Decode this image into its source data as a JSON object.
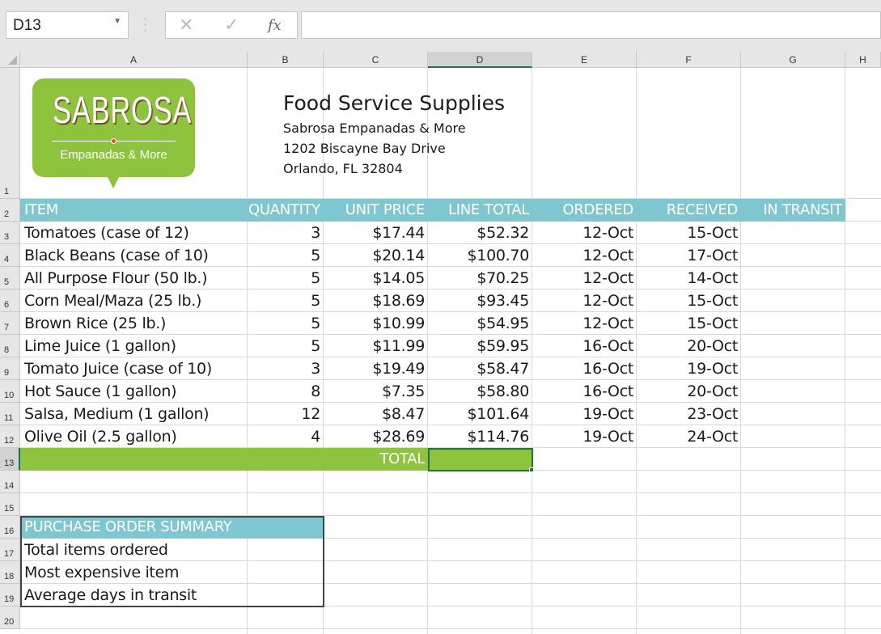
{
  "toolbar": {
    "name_box": "D13",
    "cancel_icon": "✕",
    "enter_icon": "✓",
    "fx_label": "fx",
    "formula": ""
  },
  "columns": [
    "A",
    "B",
    "C",
    "D",
    "E",
    "F",
    "G",
    "H"
  ],
  "rows": [
    "1",
    "2",
    "3",
    "4",
    "5",
    "6",
    "7",
    "8",
    "9",
    "10",
    "11",
    "12",
    "13",
    "14",
    "15",
    "16",
    "17",
    "18",
    "19",
    "20"
  ],
  "logo": {
    "title": "SABROSA",
    "subtitle": "Empanadas & More"
  },
  "company": {
    "heading": "Food Service Supplies",
    "name": "Sabrosa Empanadas & More",
    "address1": "1202 Biscayne Bay Drive",
    "address2": "Orlando, FL 32804"
  },
  "table": {
    "headers": [
      "ITEM",
      "QUANTITY",
      "UNIT PRICE",
      "LINE TOTAL",
      "ORDERED",
      "RECEIVED",
      "IN TRANSIT"
    ],
    "rows": [
      [
        "Tomatoes (case of 12)",
        "3",
        "$17.44",
        "$52.32",
        "12-Oct",
        "15-Oct"
      ],
      [
        "Black Beans (case of 10)",
        "5",
        "$20.14",
        "$100.70",
        "12-Oct",
        "17-Oct"
      ],
      [
        "All Purpose Flour (50 lb.)",
        "5",
        "$14.05",
        "$70.25",
        "12-Oct",
        "14-Oct"
      ],
      [
        "Corn Meal/Maza (25 lb.)",
        "5",
        "$18.69",
        "$93.45",
        "12-Oct",
        "15-Oct"
      ],
      [
        "Brown Rice (25 lb.)",
        "5",
        "$10.99",
        "$54.95",
        "12-Oct",
        "15-Oct"
      ],
      [
        "Lime Juice (1 gallon)",
        "5",
        "$11.99",
        "$59.95",
        "16-Oct",
        "20-Oct"
      ],
      [
        "Tomato Juice (case of 10)",
        "3",
        "$19.49",
        "$58.47",
        "16-Oct",
        "19-Oct"
      ],
      [
        "Hot Sauce (1 gallon)",
        "8",
        "$7.35",
        "$58.80",
        "16-Oct",
        "20-Oct"
      ],
      [
        "Salsa, Medium (1 gallon)",
        "12",
        "$8.47",
        "$101.64",
        "19-Oct",
        "23-Oct"
      ],
      [
        "Olive Oil (2.5 gallon)",
        "4",
        "$28.69",
        "$114.76",
        "19-Oct",
        "24-Oct"
      ]
    ],
    "total_label": "TOTAL"
  },
  "summary": {
    "title": "PURCHASE ORDER SUMMARY",
    "items": [
      "Total items ordered",
      "Most expensive item",
      "Average days in transit"
    ]
  },
  "colors": {
    "teal": "#7ec7d0",
    "green": "#8dc33d",
    "select": "#217346"
  }
}
